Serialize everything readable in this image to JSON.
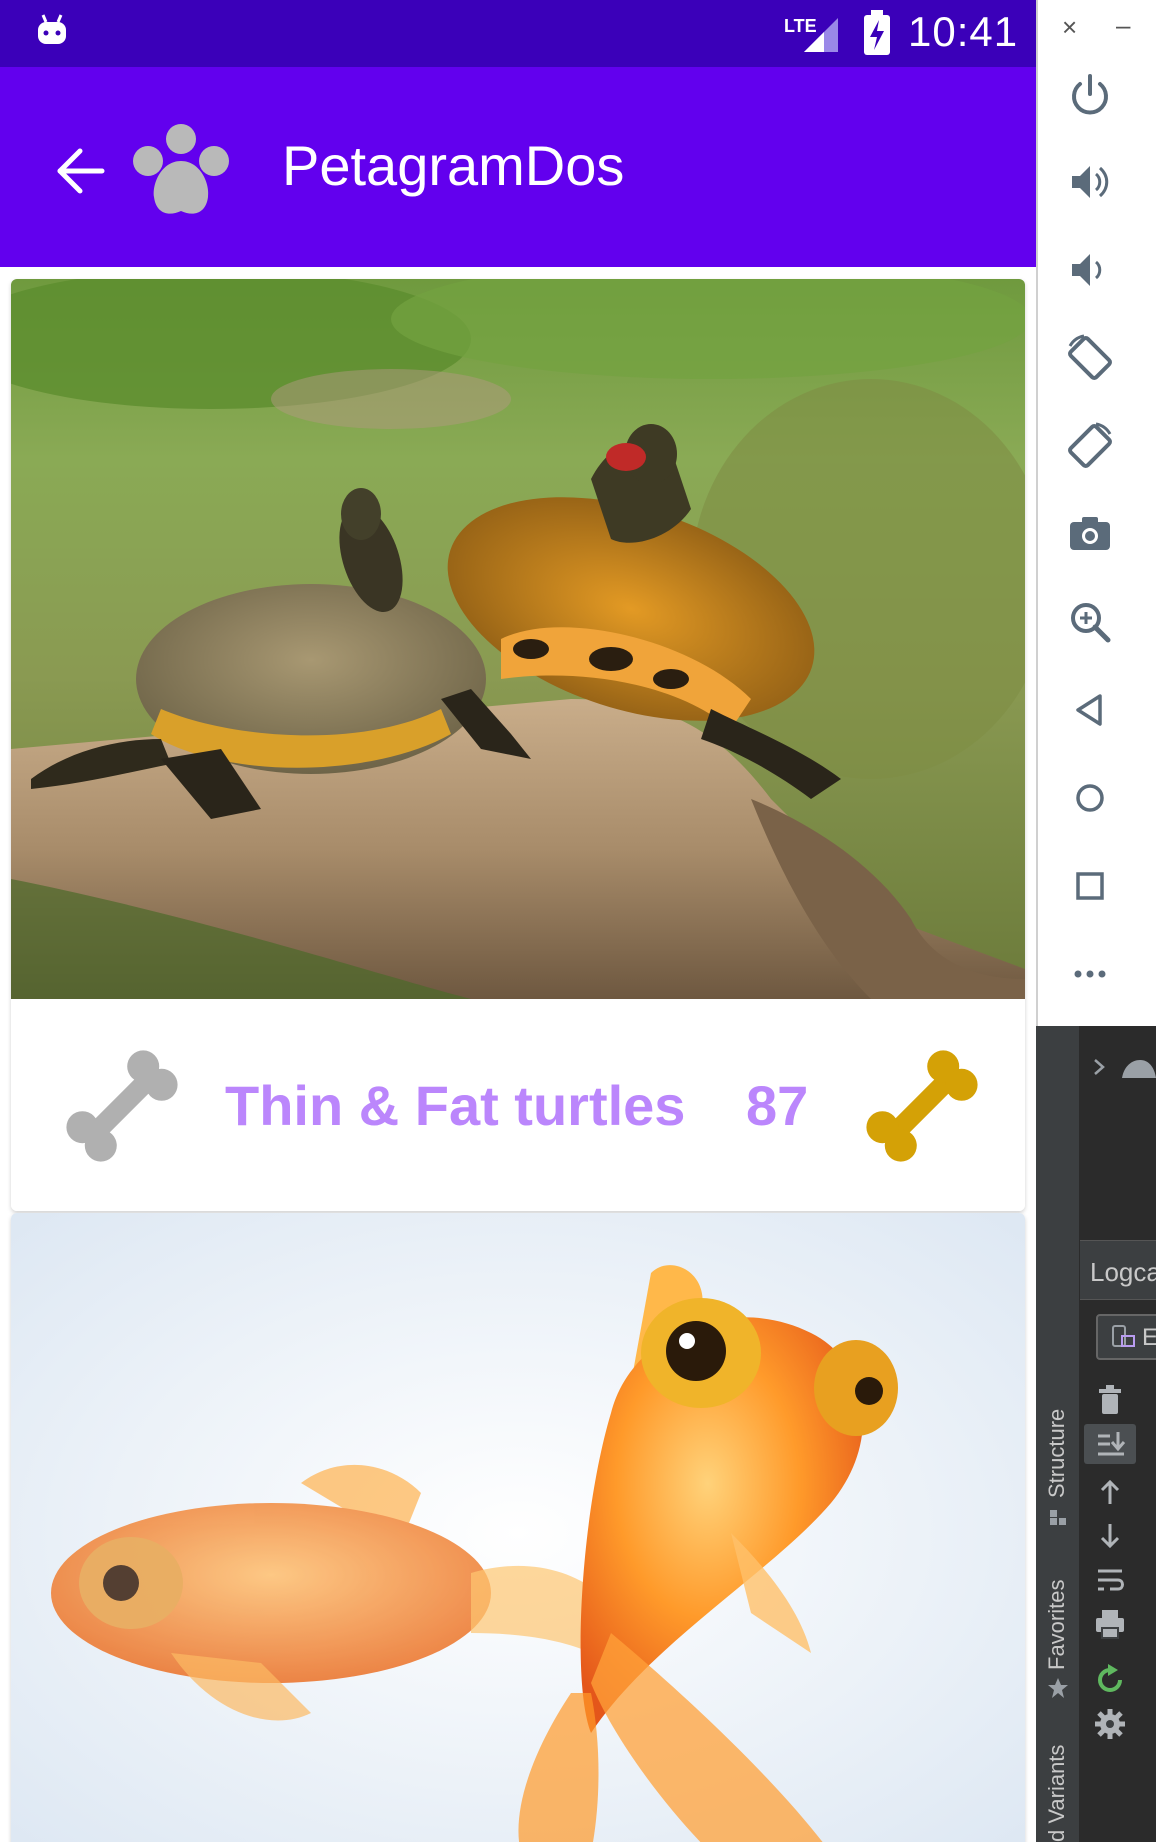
{
  "status_bar": {
    "time": "10:41",
    "network": "LTE",
    "bg_color": "#3b00b9"
  },
  "app_bar": {
    "title": "PetagramDos",
    "back_icon": "arrow-back-icon",
    "logo_icon": "paw-icon",
    "bg_color": "#6200ee"
  },
  "cards": [
    {
      "photo_desc_icon": "turtles-photo",
      "name": "Thin & Fat turtles",
      "likes": "87",
      "like_button_icon": "bone-icon",
      "rating_icon": "bone-icon"
    },
    {
      "photo_desc_icon": "goldfish-photo"
    }
  ],
  "colors": {
    "accent_text": "#bb86fc",
    "bone_inactive": "#b0b0b0",
    "bone_active": "#d4a106"
  },
  "emulator_toolbar": {
    "close": "×",
    "minimize": "–",
    "buttons": [
      "power-icon",
      "volume-up-icon",
      "volume-down-icon",
      "rotate-left-icon",
      "rotate-right-icon",
      "camera-icon",
      "zoom-icon",
      "back-icon",
      "home-icon",
      "overview-icon",
      "more-icon"
    ]
  },
  "ide": {
    "logcat_tab": "Logca",
    "device_label": "E",
    "side_tabs": [
      "Structure",
      "Favorites",
      "d Variants"
    ],
    "tools": [
      "trash-icon",
      "scroll-end-icon",
      "up-arrow-icon",
      "down-arrow-icon",
      "soft-wrap-icon",
      "print-icon",
      "restart-icon",
      "settings-icon"
    ]
  }
}
